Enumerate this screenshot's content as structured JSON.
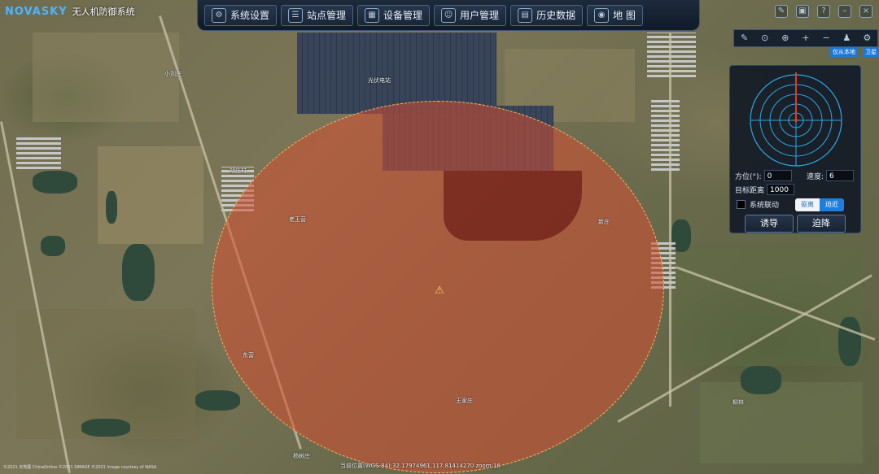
{
  "app": {
    "logo_text": "NOVASKY",
    "title": "无人机防御系统"
  },
  "nav": {
    "items": [
      {
        "label": "系统设置",
        "icon": "settings-icon"
      },
      {
        "label": "站点管理",
        "icon": "site-icon"
      },
      {
        "label": "设备管理",
        "icon": "device-icon"
      },
      {
        "label": "用户管理",
        "icon": "user-icon"
      },
      {
        "label": "历史数据",
        "icon": "chart-icon"
      },
      {
        "label": "地 图",
        "icon": "map-pin-icon"
      }
    ]
  },
  "window_controls": [
    "edit-icon",
    "lock-icon",
    "help-icon",
    "minimize-icon",
    "close-icon"
  ],
  "map_tools": [
    "pencil-icon",
    "locate-icon",
    "target-icon",
    "zoom-in-icon",
    "zoom-out-icon",
    "user-marker-icon",
    "settings-icon"
  ],
  "layer_switch": {
    "option_a": "仅从本地",
    "option_b": "卫星"
  },
  "radar_panel": {
    "azimuth_label": "方位(°):",
    "azimuth_value": "0",
    "speed_label": "速度:",
    "speed_value": "6",
    "distance_label": "目标距离",
    "distance_value": "1000",
    "linkage_label": "系统联动",
    "toggle_left": "驱离",
    "toggle_right": "迫近",
    "lure_button": "诱导",
    "land_button": "迫降"
  },
  "map": {
    "labels": [
      "光伏电站",
      "小刘庄",
      "胡庄村",
      "老王营",
      "东营",
      "王家庄",
      "新庄",
      "柳林",
      "杨树庄"
    ],
    "copyright": "©2021 天地图 ChinaOnline ©2021 SIMAGE ©2021 Image courtesy of NASA",
    "coordinates": "当前位置(WGS-84):32.17974961,117.81414270 zoom:16"
  },
  "colors": {
    "accent": "#1c7fe0",
    "zone": "#d64e32",
    "radar": "#2aa8e8"
  }
}
